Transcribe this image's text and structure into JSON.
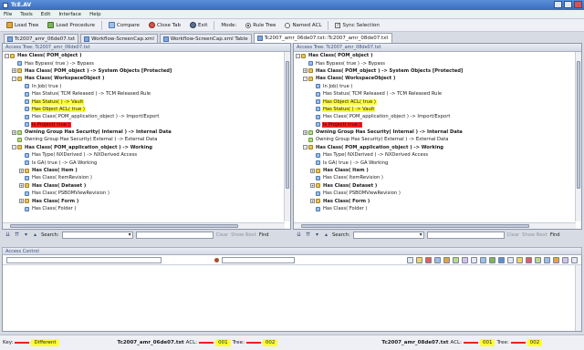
{
  "window": {
    "title": "TcE.AV"
  },
  "menu": [
    "File",
    "Tools",
    "Edit",
    "Interface",
    "Help"
  ],
  "toolbar": {
    "load_tree": "Load Tree",
    "load_procedure": "Load Procedure",
    "compare": "Compare",
    "close_tab": "Close Tab",
    "exit": "Exit",
    "mode_label": "Mode:",
    "mode_rule_tree": "Rule Tree",
    "mode_named_acl": "Named ACL",
    "sync_selection": "Sync Selection"
  },
  "tabs": [
    {
      "label": "Tc2007_amr_06de07.txt",
      "active": false
    },
    {
      "label": "Workflow-ScreenCap.xml",
      "active": false
    },
    {
      "label": "Workflow-ScreenCap.xml Table",
      "active": false
    },
    {
      "label": "Tc2007_amr_06de07.txt::Tc2007_amr_08de07.txt",
      "active": true
    }
  ],
  "left_pane": {
    "header": "Access Tree: Tc2007_amr_06de07.txt",
    "rows": [
      {
        "text": "Has Class( POM_object )",
        "bold": true,
        "exp": "-",
        "indent": 0,
        "icon": "cls",
        "hl": ""
      },
      {
        "text": "Has Bypass( true ) -> Bypass",
        "bold": false,
        "exp": "",
        "indent": 1,
        "icon": "prop",
        "hl": ""
      },
      {
        "text": "Has Class( POM_object ) -> System Objects [Protected]",
        "bold": true,
        "exp": "+",
        "indent": 1,
        "icon": "cls",
        "hl": ""
      },
      {
        "text": "Has Class( WorkspaceObject )",
        "bold": true,
        "exp": "-",
        "indent": 1,
        "icon": "cls",
        "hl": ""
      },
      {
        "text": "In Job( true )",
        "bold": false,
        "exp": "",
        "indent": 2,
        "icon": "prop",
        "hl": ""
      },
      {
        "text": "Has Status( TCM Released ) -> TCM Released Rule",
        "bold": false,
        "exp": "",
        "indent": 2,
        "icon": "prop",
        "hl": ""
      },
      {
        "text": "Has Status( ) -> Vault",
        "bold": false,
        "exp": "",
        "indent": 2,
        "icon": "prop",
        "hl": "yellow"
      },
      {
        "text": "Has Object ACL( true )",
        "bold": false,
        "exp": "",
        "indent": 2,
        "icon": "prop",
        "hl": "yellow"
      },
      {
        "text": "Has Class( POM_application_object ) -> Import/Export",
        "bold": false,
        "exp": "",
        "indent": 2,
        "icon": "prop",
        "hl": ""
      },
      {
        "text": "Is Project( true )",
        "bold": false,
        "exp": "",
        "indent": 2,
        "icon": "prop",
        "hl": "red"
      },
      {
        "text": "Owning Group Has Security( Internal ) -> Internal Data",
        "bold": true,
        "exp": "+",
        "indent": 1,
        "icon": "grp",
        "hl": ""
      },
      {
        "text": "Owning Group Has Security( External ) -> External Data",
        "bold": false,
        "exp": "",
        "indent": 1,
        "icon": "grp",
        "hl": ""
      },
      {
        "text": "Has Class( POM_application_object ) -> Working",
        "bold": true,
        "exp": "-",
        "indent": 1,
        "icon": "cls",
        "hl": ""
      },
      {
        "text": "Has Type( NXDerived ) -> NXDerived Access",
        "bold": false,
        "exp": "",
        "indent": 2,
        "icon": "prop",
        "hl": ""
      },
      {
        "text": "Is GA( true ) -> GA Working",
        "bold": false,
        "exp": "",
        "indent": 2,
        "icon": "prop",
        "hl": ""
      },
      {
        "text": "Has Class( Item )",
        "bold": true,
        "exp": "+",
        "indent": 2,
        "icon": "cls",
        "hl": ""
      },
      {
        "text": "Has Class( ItemRevision )",
        "bold": false,
        "exp": "",
        "indent": 2,
        "icon": "prop",
        "hl": ""
      },
      {
        "text": "Has Class( Dataset )",
        "bold": true,
        "exp": "+",
        "indent": 2,
        "icon": "cls",
        "hl": ""
      },
      {
        "text": "Has Class( PSBOMViewRevision )",
        "bold": false,
        "exp": "",
        "indent": 2,
        "icon": "prop",
        "hl": ""
      },
      {
        "text": "Has Class( Form )",
        "bold": true,
        "exp": "+",
        "indent": 2,
        "icon": "cls",
        "hl": ""
      },
      {
        "text": "Has Class( Folder )",
        "bold": false,
        "exp": "",
        "indent": 2,
        "icon": "prop",
        "hl": ""
      }
    ]
  },
  "right_pane": {
    "header": "Access Tree: Tc2007_amr_08de07.txt",
    "rows": [
      {
        "text": "Has Class( POM_object )",
        "bold": true,
        "exp": "-",
        "indent": 0,
        "icon": "cls",
        "hl": ""
      },
      {
        "text": "Has Bypass( true ) -> Bypass",
        "bold": false,
        "exp": "",
        "indent": 1,
        "icon": "prop",
        "hl": ""
      },
      {
        "text": "Has Class( POM_object ) -> System Objects [Protected]",
        "bold": true,
        "exp": "+",
        "indent": 1,
        "icon": "cls",
        "hl": ""
      },
      {
        "text": "Has Class( WorkspaceObject )",
        "bold": true,
        "exp": "-",
        "indent": 1,
        "icon": "cls",
        "hl": ""
      },
      {
        "text": "In Job( true )",
        "bold": false,
        "exp": "",
        "indent": 2,
        "icon": "prop",
        "hl": ""
      },
      {
        "text": "Has Status( TCM Released ) -> TCM Released Rule",
        "bold": false,
        "exp": "",
        "indent": 2,
        "icon": "prop",
        "hl": ""
      },
      {
        "text": "Has Object ACL( true )",
        "bold": false,
        "exp": "",
        "indent": 2,
        "icon": "prop",
        "hl": "yellow"
      },
      {
        "text": "Has Status( ) -> Vault",
        "bold": false,
        "exp": "",
        "indent": 2,
        "icon": "prop",
        "hl": "yellow"
      },
      {
        "text": "Has Class( POM_application_object ) -> Import/Export",
        "bold": false,
        "exp": "",
        "indent": 2,
        "icon": "prop",
        "hl": ""
      },
      {
        "text": "Is Project( true )",
        "bold": false,
        "exp": "",
        "indent": 2,
        "icon": "prop",
        "hl": "red"
      },
      {
        "text": "Owning Group Has Security( Internal ) -> Internal Data",
        "bold": true,
        "exp": "+",
        "indent": 1,
        "icon": "grp",
        "hl": ""
      },
      {
        "text": "Owning Group Has Security( External ) -> External Data",
        "bold": false,
        "exp": "",
        "indent": 1,
        "icon": "grp",
        "hl": ""
      },
      {
        "text": "Has Class( POM_application_object ) -> Working",
        "bold": true,
        "exp": "-",
        "indent": 1,
        "icon": "cls",
        "hl": ""
      },
      {
        "text": "Has Type( NXDerived ) -> NXDerived Access",
        "bold": false,
        "exp": "",
        "indent": 2,
        "icon": "prop",
        "hl": ""
      },
      {
        "text": "Is GA( true ) -> GA Working",
        "bold": false,
        "exp": "",
        "indent": 2,
        "icon": "prop",
        "hl": ""
      },
      {
        "text": "Has Class( Item )",
        "bold": true,
        "exp": "+",
        "indent": 2,
        "icon": "cls",
        "hl": ""
      },
      {
        "text": "Has Class( ItemRevision )",
        "bold": false,
        "exp": "",
        "indent": 2,
        "icon": "prop",
        "hl": ""
      },
      {
        "text": "Has Class( Dataset )",
        "bold": true,
        "exp": "+",
        "indent": 2,
        "icon": "cls",
        "hl": ""
      },
      {
        "text": "Has Class( PSBOMViewRevision )",
        "bold": false,
        "exp": "",
        "indent": 2,
        "icon": "prop",
        "hl": ""
      },
      {
        "text": "Has Class( Form )",
        "bold": true,
        "exp": "+",
        "indent": 2,
        "icon": "cls",
        "hl": ""
      },
      {
        "text": "Has Class( Folder )",
        "bold": false,
        "exp": "",
        "indent": 2,
        "icon": "prop",
        "hl": ""
      }
    ]
  },
  "search": {
    "label": "Search:",
    "clear": "Clear",
    "show_next": "Show Next",
    "find": "Find"
  },
  "access_control": {
    "header": "Access Control"
  },
  "status": {
    "key_label": "Key:",
    "different_label": "Different",
    "left_file": "Tc2007_amr_06de07.txt",
    "right_file": "Tc2007_amr_08de07.txt",
    "acl_label": "ACL:",
    "tree_label": "Tree:",
    "left_acl": "001",
    "left_tree": "002",
    "right_acl": "001",
    "right_tree": "002"
  },
  "colors": {
    "highlight_yellow": "#ffff30",
    "highlight_red": "#ee2020",
    "title_bar": "#3a6cc0"
  }
}
